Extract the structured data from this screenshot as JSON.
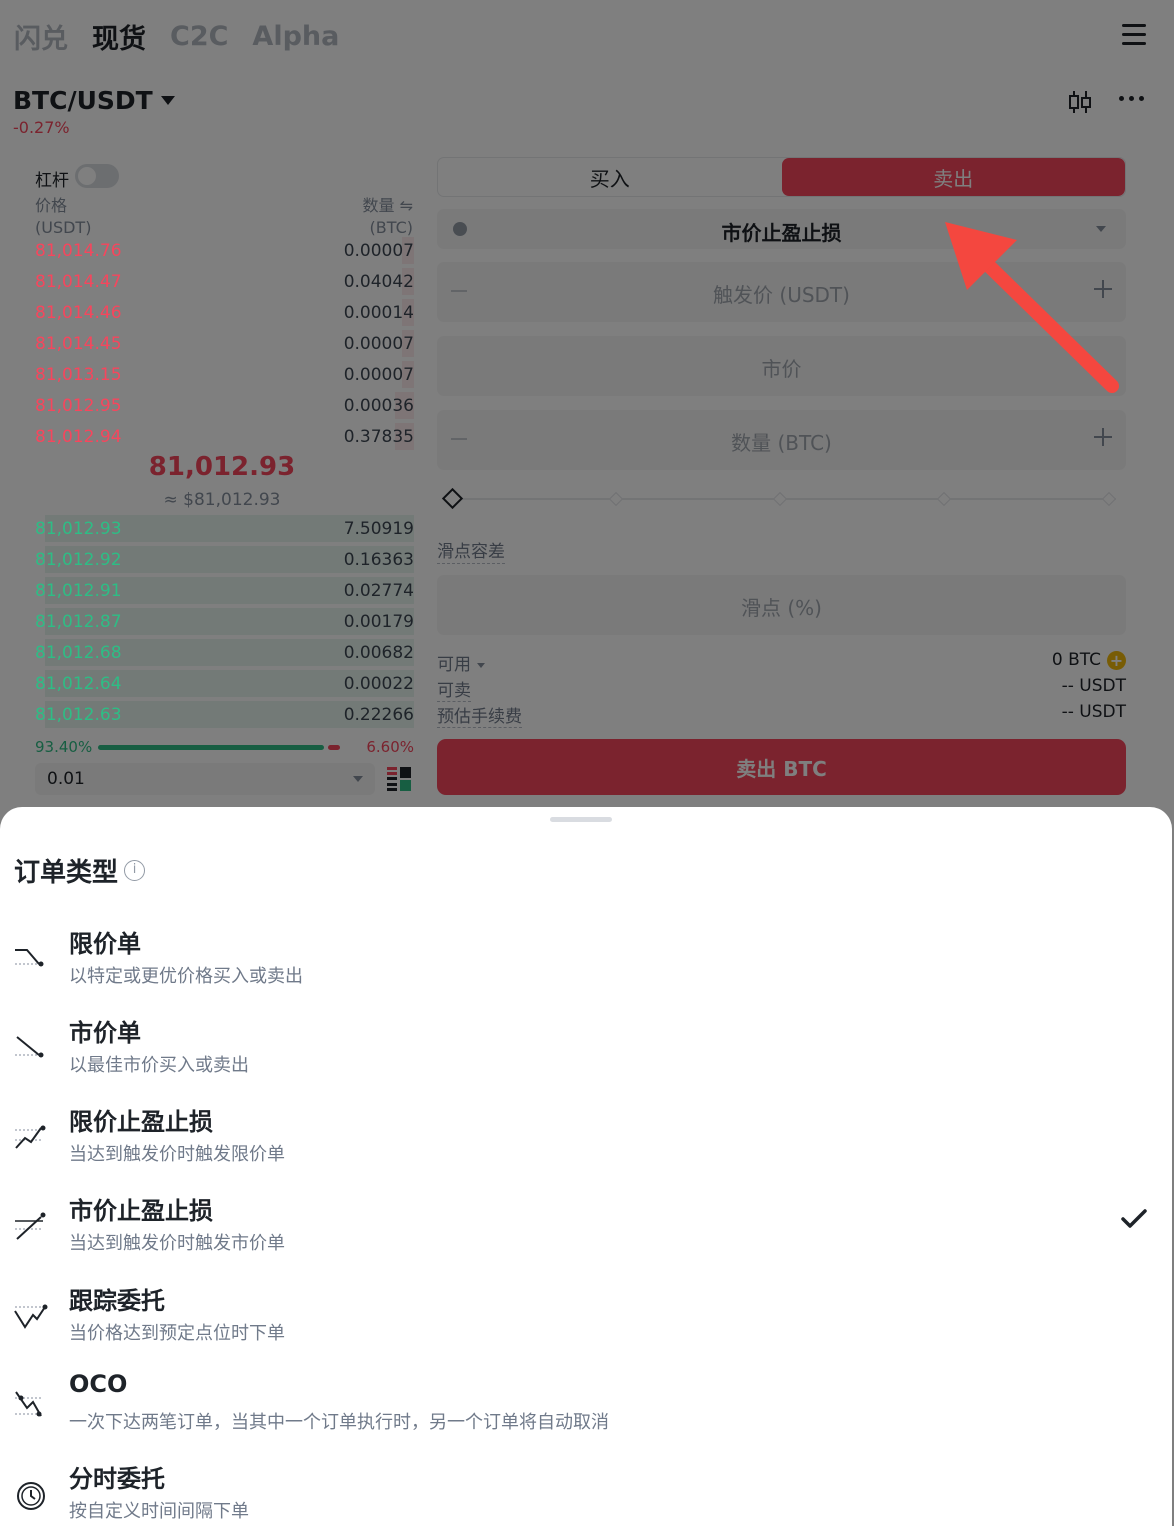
{
  "nav": {
    "tabs": [
      {
        "label": "闪兑",
        "active": false
      },
      {
        "label": "现货",
        "active": true
      },
      {
        "label": "C2C",
        "active": false
      },
      {
        "label": "Alpha",
        "active": false
      }
    ]
  },
  "pair": {
    "name": "BTC/USDT",
    "change": "-0.27%"
  },
  "orderbook": {
    "leverage_label": "杠杆",
    "price_header": "价格",
    "price_unit": "(USDT)",
    "qty_header": "数量 ⇋",
    "qty_unit": "(BTC)",
    "asks": [
      {
        "price": "81,014.76",
        "qty": "0.00007",
        "depth": 0.03
      },
      {
        "price": "81,014.47",
        "qty": "0.04042",
        "depth": 0.03
      },
      {
        "price": "81,014.46",
        "qty": "0.00014",
        "depth": 0.03
      },
      {
        "price": "81,014.45",
        "qty": "0.00007",
        "depth": 0.03
      },
      {
        "price": "81,013.15",
        "qty": "0.00007",
        "depth": 0.03
      },
      {
        "price": "81,012.95",
        "qty": "0.00036",
        "depth": 0.05
      },
      {
        "price": "81,012.94",
        "qty": "0.37835",
        "depth": 0.05
      }
    ],
    "last_price": "81,012.93",
    "last_price_usd": "≈ $81,012.93",
    "bids": [
      {
        "price": "81,012.93",
        "qty": "7.50919",
        "depth": 0.96
      },
      {
        "price": "81,012.92",
        "qty": "0.16363",
        "depth": 0.96
      },
      {
        "price": "81,012.91",
        "qty": "0.02774",
        "depth": 0.96
      },
      {
        "price": "81,012.87",
        "qty": "0.00179",
        "depth": 0.96
      },
      {
        "price": "81,012.68",
        "qty": "0.00682",
        "depth": 0.96
      },
      {
        "price": "81,012.64",
        "qty": "0.00022",
        "depth": 0.96
      },
      {
        "price": "81,012.63",
        "qty": "0.22266",
        "depth": 0.96
      }
    ],
    "buy_ratio": "93.40%",
    "sell_ratio": "6.60%",
    "buy_ratio_value": 93.4,
    "depth_value": "0.01"
  },
  "trade": {
    "buy_tab": "买入",
    "sell_tab": "卖出",
    "order_type": "市价止盈止损",
    "trigger_placeholder": "触发价 (USDT)",
    "market_placeholder": "市价",
    "amount_placeholder": "数量 (BTC)",
    "slippage_label": "滑点容差",
    "slippage_placeholder": "滑点 (%)",
    "available_label": "可用",
    "available_value": "0 BTC",
    "sellable_label": "可卖",
    "sellable_value": "-- USDT",
    "fee_label": "预估手续费",
    "fee_value": "-- USDT",
    "sell_button": "卖出 BTC"
  },
  "sheet": {
    "title": "订单类型",
    "options": [
      {
        "title": "限价单",
        "desc": "以特定或更优价格买入或卖出",
        "icon": "limit-order-icon",
        "selected": false
      },
      {
        "title": "市价单",
        "desc": "以最佳市价买入或卖出",
        "icon": "market-order-icon",
        "selected": false
      },
      {
        "title": "限价止盈止损",
        "desc": "当达到触发价时触发限价单",
        "icon": "stop-limit-icon",
        "selected": false
      },
      {
        "title": "市价止盈止损",
        "desc": "当达到触发价时触发市价单",
        "icon": "stop-market-icon",
        "selected": true
      },
      {
        "title": "跟踪委托",
        "desc": "当价格达到预定点位时下单",
        "icon": "trailing-stop-icon",
        "selected": false
      },
      {
        "title": "OCO",
        "desc": "一次下达两笔订单，当其中一个订单执行时，另一个订单将自动取消",
        "icon": "oco-icon",
        "selected": false
      },
      {
        "title": "分时委托",
        "desc": "按自定义时间间隔下单",
        "icon": "twap-clock-icon",
        "selected": false
      }
    ]
  },
  "colors": {
    "sell": "#f6465d",
    "buy": "#2ebd85",
    "arrow": "#f4473f"
  }
}
